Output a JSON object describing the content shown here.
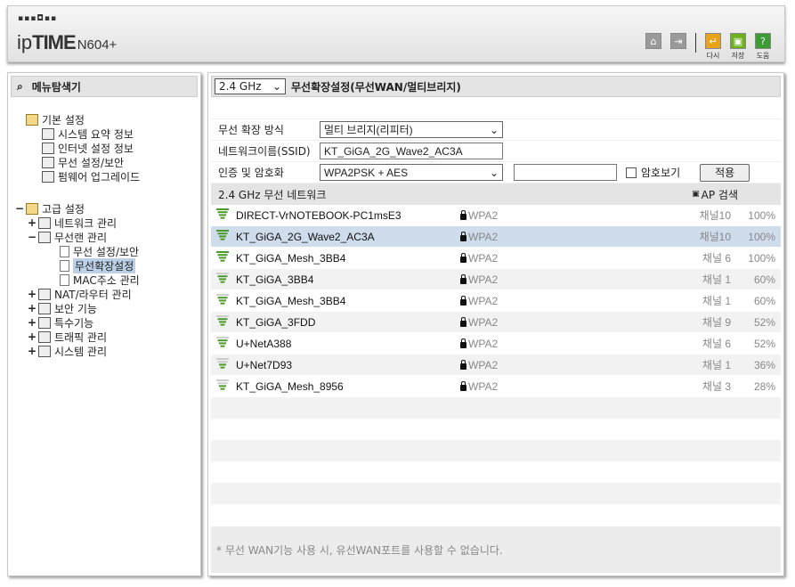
{
  "header": {
    "logo_dots": "▪▪▪◘▪▪",
    "logo_ip": "ip",
    "logo_time": "TIME",
    "logo_model": "N604+",
    "buttons": {
      "home": "⌂",
      "logout": "⇥",
      "reload": "다시",
      "save": "저장",
      "help": "도움"
    }
  },
  "sidebar": {
    "title": "메뉴탐색기",
    "basic": {
      "label": "기본 설정",
      "items": [
        "시스템 요약 정보",
        "인터넷 설정 정보",
        "무선 설정/보안",
        "펌웨어 업그레이드"
      ]
    },
    "advanced": {
      "toggle": "−",
      "label": "고급 설정",
      "items": [
        {
          "toggle": "+",
          "label": "네트워크 관리"
        },
        {
          "toggle": "−",
          "label": "무선랜 관리",
          "children": [
            "무선 설정/보안",
            "무선확장설정",
            "MAC주소 관리"
          ]
        },
        {
          "toggle": "+",
          "label": "NAT/라우터 관리"
        },
        {
          "toggle": "+",
          "label": "보안 기능"
        },
        {
          "toggle": "+",
          "label": "특수기능"
        },
        {
          "toggle": "+",
          "label": "트래픽 관리"
        },
        {
          "toggle": "+",
          "label": "시스템 관리"
        }
      ]
    }
  },
  "main": {
    "band": "2.4 GHz",
    "title": "무선확장설정(무선WAN/멀티브리지)",
    "form": {
      "mode_label": "무선 확장 방식",
      "mode_value": "멀티 브리지(리피터)",
      "ssid_label": "네트워크이름(SSID)",
      "ssid_value": "KT_GiGA_2G_Wave2_AC3A",
      "auth_label": "인증 및 암호화",
      "auth_value": "WPA2PSK + AES",
      "password_value": "",
      "show_password_label": "암호보기",
      "apply_label": "적용"
    },
    "list_title": "2.4 GHz 무선 네트워크",
    "ap_search_label": "AP 검색",
    "networks": [
      {
        "ssid": "DIRECT-VrNOTEBOOK-PC1msE3",
        "security": "WPA2",
        "channel": "채널10",
        "signal": "100%",
        "bars": 4,
        "selected": false
      },
      {
        "ssid": "KT_GiGA_2G_Wave2_AC3A",
        "security": "WPA2",
        "channel": "채널10",
        "signal": "100%",
        "bars": 4,
        "selected": true
      },
      {
        "ssid": "KT_GiGA_Mesh_3BB4",
        "security": "WPA2",
        "channel": "채널 6",
        "signal": "100%",
        "bars": 4,
        "selected": false
      },
      {
        "ssid": "KT_GiGA_3BB4",
        "security": "WPA2",
        "channel": "채널 1",
        "signal": "60%",
        "bars": 3,
        "selected": false
      },
      {
        "ssid": "KT_GiGA_Mesh_3BB4",
        "security": "WPA2",
        "channel": "채널 1",
        "signal": "60%",
        "bars": 3,
        "selected": false
      },
      {
        "ssid": "KT_GiGA_3FDD",
        "security": "WPA2",
        "channel": "채널 9",
        "signal": "52%",
        "bars": 3,
        "selected": false
      },
      {
        "ssid": "U+NetA388",
        "security": "WPA2",
        "channel": "채널 6",
        "signal": "52%",
        "bars": 3,
        "selected": false
      },
      {
        "ssid": "U+Net7D93",
        "security": "WPA2",
        "channel": "채널 1",
        "signal": "36%",
        "bars": 2,
        "selected": false
      },
      {
        "ssid": "KT_GiGA_Mesh_8956",
        "security": "WPA2",
        "channel": "채널 3",
        "signal": "28%",
        "bars": 2,
        "selected": false
      }
    ],
    "footer_note": "* 무선 WAN기능 사용 시, 유선WAN포트를 사용할 수 없습니다."
  },
  "colors": {
    "signal_green": "#4a9a2a",
    "signal_gray": "#cccccc",
    "selected_row": "#cfdcec"
  }
}
